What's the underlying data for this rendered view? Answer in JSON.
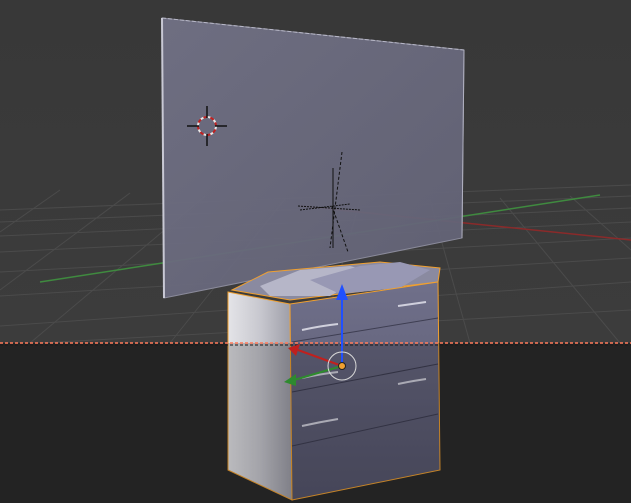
{
  "viewport": {
    "name": "3D Viewport",
    "colors": {
      "background_top": "#3a3a3a",
      "background_bottom": "#2b2b2b",
      "grid": "#4a4a4a",
      "x_axis": "#8a2a2a",
      "y_axis": "#3f8a3f",
      "selection_outline": "#f0a030",
      "clip_boundary": "#ff7a5a"
    }
  },
  "scene": {
    "objects": [
      {
        "name": "image-plane",
        "selected": false,
        "color": "#6e6e80"
      },
      {
        "name": "dresser",
        "selected": true,
        "color": "#6a6a84"
      }
    ],
    "cursor": {
      "icon": "3d-cursor-icon"
    },
    "transform_gizmo": {
      "icon": "translate-gizmo-icon",
      "z_color": "#2050ff",
      "x_color": "#c0201e",
      "y_color": "#2e8a2e"
    }
  }
}
